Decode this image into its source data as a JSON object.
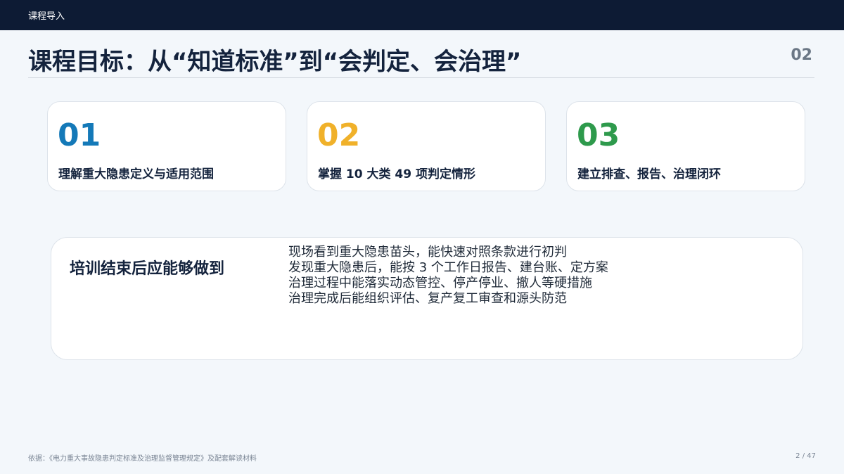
{
  "header": {
    "section": "课程导入"
  },
  "title": "课程目标：从“知道标准”到“会判定、会治理”",
  "page_number": "02",
  "cards": [
    {
      "number": "01",
      "text": "理解重大隐患定义与适用范围",
      "color": "#1479b8"
    },
    {
      "number": "02",
      "text": "掌握 10 大类 49 项判定情形",
      "color": "#f0b12a"
    },
    {
      "number": "03",
      "text": "建立排查、报告、治理闭环",
      "color": "#2e9a4c"
    }
  ],
  "goals": {
    "title": "培训结束后应能够做到",
    "items": [
      "现场看到重大隐患苗头，能快速对照条款进行初判",
      "发现重大隐患后，能按 3 个工作日报告、建台账、定方案",
      "治理过程中能落实动态管控、停产停业、撤人等硬措施",
      "治理完成后能组织评估、复产复工审查和源头防范"
    ]
  },
  "footer": {
    "source": "依据：《电力重大事故隐患判定标准及治理监督管理规定》及配套解读材料",
    "page": "2 / 47"
  }
}
